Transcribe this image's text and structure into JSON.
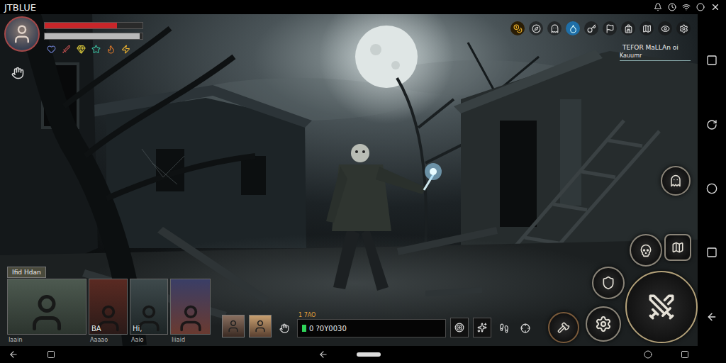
{
  "status_bar": {
    "carrier": "JTBLUE"
  },
  "player": {
    "health": 0.74,
    "stamina": 0.97
  },
  "quest": {
    "title": "TEFOR MaLLAn oi",
    "subtitle": "Kauumr"
  },
  "party": {
    "label": "Ifid Hdan",
    "members": [
      {
        "caption": "Iaain"
      },
      {
        "tag": "BA",
        "caption": "Aaaao"
      },
      {
        "tag": "Hi,",
        "caption": "Aaio"
      },
      {
        "caption": "Iiiaid"
      }
    ]
  },
  "action_bar": {
    "count": "1 7AO",
    "reading": "0 ?0Y0030"
  }
}
